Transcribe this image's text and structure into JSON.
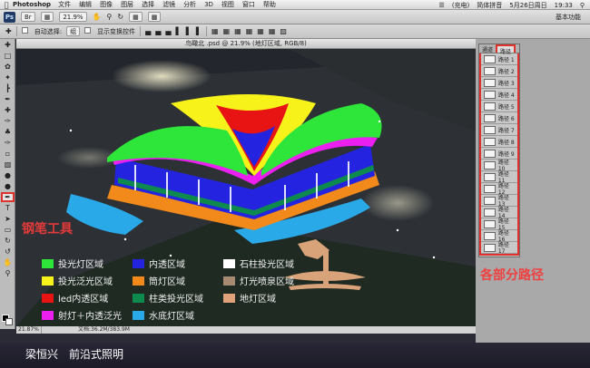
{
  "menubar": {
    "app_name": "Photoshop",
    "menus": [
      "文件",
      "编辑",
      "图像",
      "图层",
      "选择",
      "滤镜",
      "分析",
      "3D",
      "视图",
      "窗口",
      "帮助"
    ],
    "status_right": [
      "(充电)",
      "简体拼音",
      "5月26日周日",
      "19:33"
    ]
  },
  "appbar": {
    "zoom": "21.9%",
    "workspace": "基本功能"
  },
  "optbar": {
    "auto_select_label": "自动选择:",
    "auto_select_value": "组",
    "show_transform_label": "显示变换控件"
  },
  "document": {
    "title": "鸟瞰北 .psd @ 21.9% (地灯区域, RGB/8)",
    "status_zoom": "21.87%",
    "status_info": "文档:36.2M/383.9M"
  },
  "annotations": {
    "pen_tool": "钢笔工具",
    "parts_paths": "各部分路径"
  },
  "legend": [
    {
      "label": "投光灯区域",
      "color": "#2ee63a"
    },
    {
      "label": "内透区域",
      "color": "#2323e0"
    },
    {
      "label": "石柱投光区域",
      "color": "#ffffff"
    },
    {
      "label": "投光泛光区域",
      "color": "#f7f21a"
    },
    {
      "label": "筒灯区域",
      "color": "#f28a1b"
    },
    {
      "label": "灯光喷泉区域",
      "color": "#a88a72"
    },
    {
      "label": "led内透区域",
      "color": "#e81414"
    },
    {
      "label": "柱类投光区域",
      "color": "#0e8a4e"
    },
    {
      "label": "地灯区域",
      "color": "#e0a27a"
    },
    {
      "label": "射灯＋内透泛光",
      "color": "#ea1ff0"
    },
    {
      "label": "水底灯区域",
      "color": "#2aa9e8"
    }
  ],
  "paths_panel": {
    "tabs": [
      "通道",
      "路径"
    ],
    "items": [
      "路径 1",
      "路径 2",
      "路径 3",
      "路径 4",
      "路径 5",
      "路径 6",
      "路径 7",
      "路径 8",
      "路径 9",
      "路径 10",
      "路径 11",
      "路径 12",
      "路径 13",
      "路径 14",
      "路径 15",
      "路径 16",
      "路径 17"
    ]
  },
  "caption": "梁恒兴　前沿式照明"
}
